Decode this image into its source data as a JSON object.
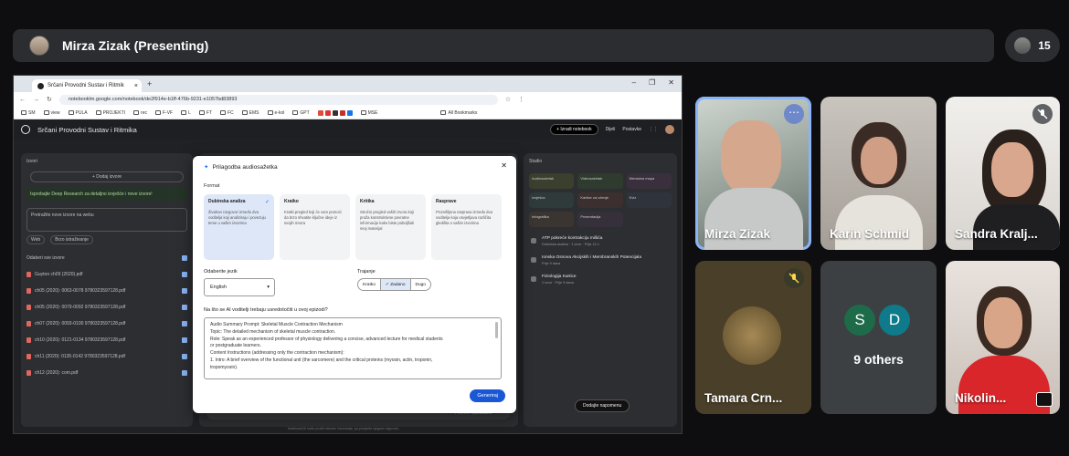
{
  "meet": {
    "presenter_label": "Mirza Zizak (Presenting)",
    "participant_count": "15",
    "participants": [
      {
        "name": "Mirza Zizak"
      },
      {
        "name": "Karin Schmid"
      },
      {
        "name": "Sandra Kralj..."
      },
      {
        "name": "Tamara Crn..."
      },
      {
        "name": "9 others",
        "initials": [
          "S",
          "D"
        ]
      },
      {
        "name": "Nikolin..."
      }
    ]
  },
  "browser": {
    "tab_title": "Srčani Provodni Sustav i Ritmik",
    "url": "notebooklm.google.com/notebook/de2f914e-b1ff-476b-9231-e1057bd83893",
    "bookmarks": [
      "SM",
      "view",
      "PULA",
      "PROJEKTI",
      "rec",
      "F-VF",
      "L",
      "FT",
      "FC",
      "EMS",
      "e-kol",
      "GPT",
      "MSE"
    ],
    "all_bookmarks": "All Bookmarks"
  },
  "notebook": {
    "title": "Srčani Provodni Sustav i Ritmika",
    "create_label": "+ Izradi notebook",
    "share_label": "Dijeli",
    "settings_label": "Postavke",
    "sources_title": "Izvori",
    "add_source": "+ Dodaj izvore",
    "promo": "Isprobajte Deep Research za detaljno izvješće i nove izvore!",
    "search_placeholder": "Pretražite nove izvore na webu",
    "chip_web": "Web",
    "chip_fast": "Brzo istraživanje",
    "select_all": "Odaberi sve izvore",
    "sources": [
      "Guyton ch09 (2020).pdf",
      "ch05 (2020): 0063-0078 9780323597128.pdf",
      "ch05 (2020): 0079-0092 9780323597128.pdf",
      "ch07 (2020): 0093-0100 9780323597128.pdf",
      "ch10 (2020): 0121-0134 9780323597128.pdf",
      "ch11 (2020): 0135-0142 9780323597128.pdf",
      "ch12 (2020): com.pdf"
    ],
    "chat_placeholder": "Počnite upisivati...",
    "chat_count": "1 izvora",
    "studio_title": "Studio",
    "studio_tiles": [
      "Audiosažetak",
      "Videosažetak",
      "Mentalna mapa",
      "Izvješća",
      "Kartice za učenje",
      "Kviz",
      "Infografika",
      "Prezentacija"
    ],
    "notes": [
      {
        "title": "ATP pokreće kontrakciju mišića",
        "sub": "Dubinska analiza · 1 izvor · Prije 11 h"
      },
      {
        "title": "Ionska Osnova Akcijskih i Membranskih Potencijala",
        "sub": "Prije 9 dana"
      },
      {
        "title": "Fiziologija Kartice",
        "sub": "1 izvor · Prije 9 dana"
      }
    ],
    "add_note": "Dodajte napomenu",
    "footnote": "NotebookLM može pružiti netočne informacije, pa provjerite njegove odgovore."
  },
  "dialog": {
    "title": "Prilagodba audiosažetka",
    "format_label": "Format",
    "formats": [
      {
        "name": "Dubinska analiza",
        "desc": "Živahan razgovor između dva voditelja koji analiziraju i povezuju teme u vašim izvorima"
      },
      {
        "name": "Kratko",
        "desc": "Kratki pregled koji će vam pomoći da brzo shvatite ključne ideje iz svojih izvora"
      },
      {
        "name": "Kritika",
        "desc": "Stručni pregled vaših izvora koji pruža konstruktivne povratne informacije kako biste poboljšali svoj materijal"
      },
      {
        "name": "Rasprave",
        "desc": "Promišljena rasprava između dva voditelja koja osvjetljava različita gledišta o vašim izvorima"
      }
    ],
    "language_label": "Odaberite jezik",
    "language_value": "English",
    "duration_label": "Trajanje",
    "durations": [
      "Kratko",
      "✓ Zadano",
      "Dugo"
    ],
    "question": "Na što se AI voditelji trebaju usredotočiti u ovoj epizodi?",
    "prompt_lines": [
      "Audio Summary Prompt: Skeletal Muscle Contraction Mechanism",
      "Topic: The detailed mechanism of skeletal muscle contraction.",
      "Role: Speak as an experienced professor of physiology delivering a concise, advanced lecture for medical students",
      "or postgraduate learners.",
      "Content Instructions (addressing only the contraction mechanism):",
      "1.     Intro: A brief overview of the functional unit (the sarcomere) and the critical proteins (myosin, actin, troponin,",
      "tropomyosin)."
    ],
    "generate_label": "Generiraj"
  }
}
